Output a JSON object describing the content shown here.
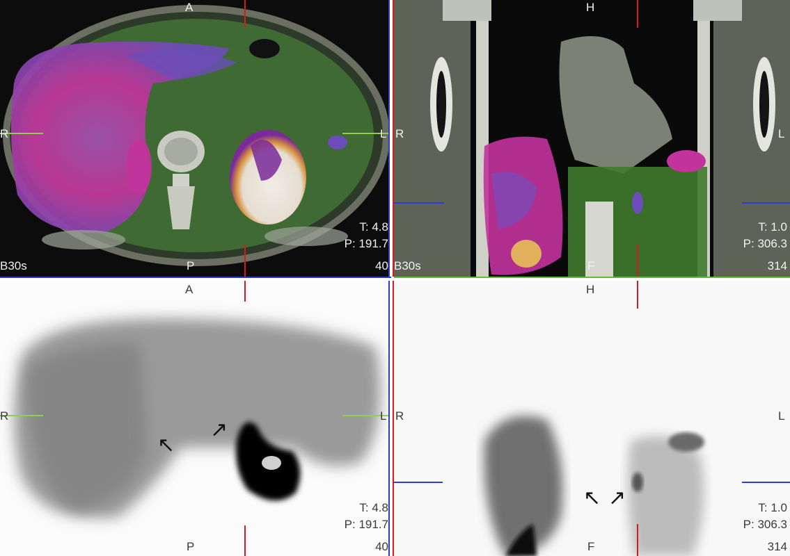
{
  "panes": {
    "axial_fused": {
      "top": "A",
      "bottom": "P",
      "left": "R",
      "right": "L",
      "thickness": "T: 4.8",
      "position": "P: 191.7",
      "slice": "40",
      "kernel": "B30s"
    },
    "coronal_fused": {
      "top": "H",
      "bottom": "F",
      "left": "R",
      "right": "L",
      "thickness": "T: 1.0",
      "position": "P: 306.3",
      "slice": "314",
      "kernel": "B30s"
    },
    "axial_pet": {
      "top": "A",
      "bottom": "P",
      "left": "R",
      "right": "L",
      "thickness": "T: 4.8",
      "position": "P: 191.7",
      "slice": "40"
    },
    "coronal_pet": {
      "top": "H",
      "bottom": "F",
      "left": "R",
      "right": "L",
      "thickness": "T: 1.0",
      "position": "P: 306.3",
      "slice": "314"
    }
  },
  "colors": {
    "crosshair_red": "#d21d1d",
    "crosshair_blue": "#2a3fd0",
    "crosshair_green": "#8fd14f",
    "fusion_green": "#3f7a2e",
    "fusion_magenta": "#c2339c"
  },
  "icons": {
    "arrow": "↖",
    "arrow_alt": "↗"
  }
}
